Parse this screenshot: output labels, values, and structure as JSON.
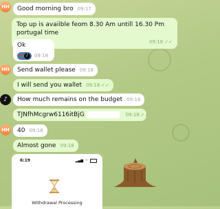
{
  "messages": [
    {
      "text": "Good morning bro",
      "time": "09:17",
      "dir": "in"
    },
    {
      "text": "Top up is avaiible feom 8.30 Am untill 16.30 Pm portugal time",
      "time": "09:18",
      "dir": "out"
    },
    {
      "text": "Ok",
      "time": "09:18",
      "dir": "in"
    },
    {
      "text": "Send wallet please",
      "time": "09:18",
      "dir": "in"
    },
    {
      "text": "I will send you wallet",
      "time": "09:18",
      "dir": "out"
    },
    {
      "text": "How much remains on the budget",
      "time": "09:18",
      "dir": "in"
    },
    {
      "text": "TJNfhMcgrw6116itBjG",
      "time": "09:18",
      "dir": "out"
    },
    {
      "text": "40",
      "time": "09:18",
      "dir": "in"
    },
    {
      "text": "Almost gone",
      "time": "09:18",
      "dir": "out"
    }
  ],
  "avatars": {
    "hh": "HH",
    "tt": "♪"
  },
  "reactions": [
    "❤",
    "♪"
  ],
  "embedded_screenshot": {
    "clock": "6:19",
    "status_title": "Withdrawal Processing"
  },
  "icon_names": [
    "double-check-icon",
    "heart-icon",
    "tiktok-icon",
    "hourglass-icon",
    "tree-stump-icon",
    "wifi-icon",
    "battery-icon",
    "signal-icon"
  ],
  "colors": {
    "incoming_bubble": "#ffffff",
    "outgoing_bubble": "#e5f9cf",
    "tick": "#6cbc5a",
    "background": "#b3c986",
    "avatar_hh": "#f0813e"
  }
}
